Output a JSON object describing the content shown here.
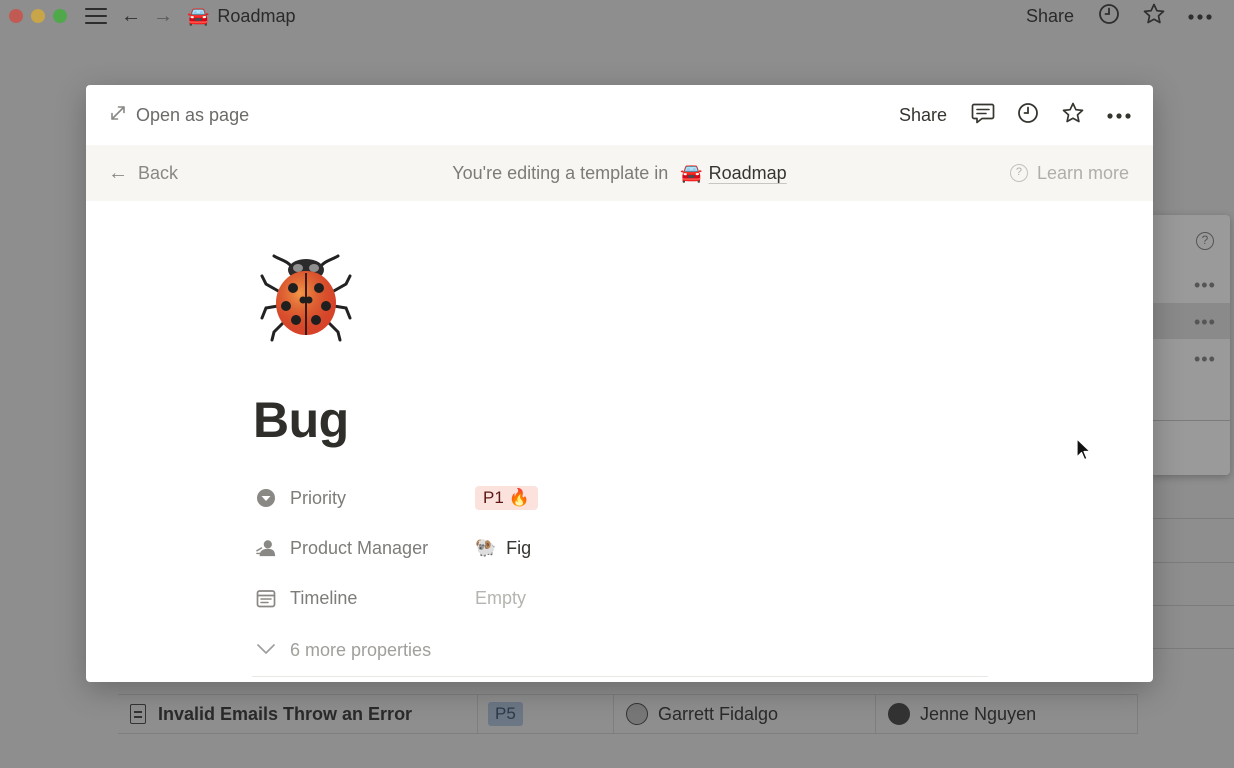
{
  "window": {
    "page_emoji": "🚘",
    "page_title": "Roadmap",
    "share_label": "Share"
  },
  "background_row": {
    "title": "Invalid Emails Throw an Error",
    "priority": "P5",
    "product_manager": "Garrett Fidalgo",
    "engineer": "Jenne Nguyen"
  },
  "modal": {
    "open_as_page_label": "Open as page",
    "share_label": "Share",
    "banner": {
      "back_label": "Back",
      "editing_text": "You're editing a template in",
      "database_emoji": "🚘",
      "database_name": "Roadmap",
      "learn_more_label": "Learn more"
    },
    "page": {
      "icon": "🐞",
      "title": "Bug",
      "properties": [
        {
          "name": "Priority",
          "icon": "priority-icon",
          "value": "P1 🔥"
        },
        {
          "name": "Product Manager",
          "icon": "person-icon",
          "value": "Fig",
          "value_icon": "🐏"
        },
        {
          "name": "Timeline",
          "icon": "calendar-icon",
          "value": "Empty"
        }
      ],
      "more_properties_label": "6 more properties"
    }
  },
  "colors": {
    "overlay_bg": "#8e8e8e",
    "banner_bg": "#f7f6f3",
    "p1_tag_bg": "#fbe2dd",
    "p1_tag_text": "#5d1715"
  }
}
